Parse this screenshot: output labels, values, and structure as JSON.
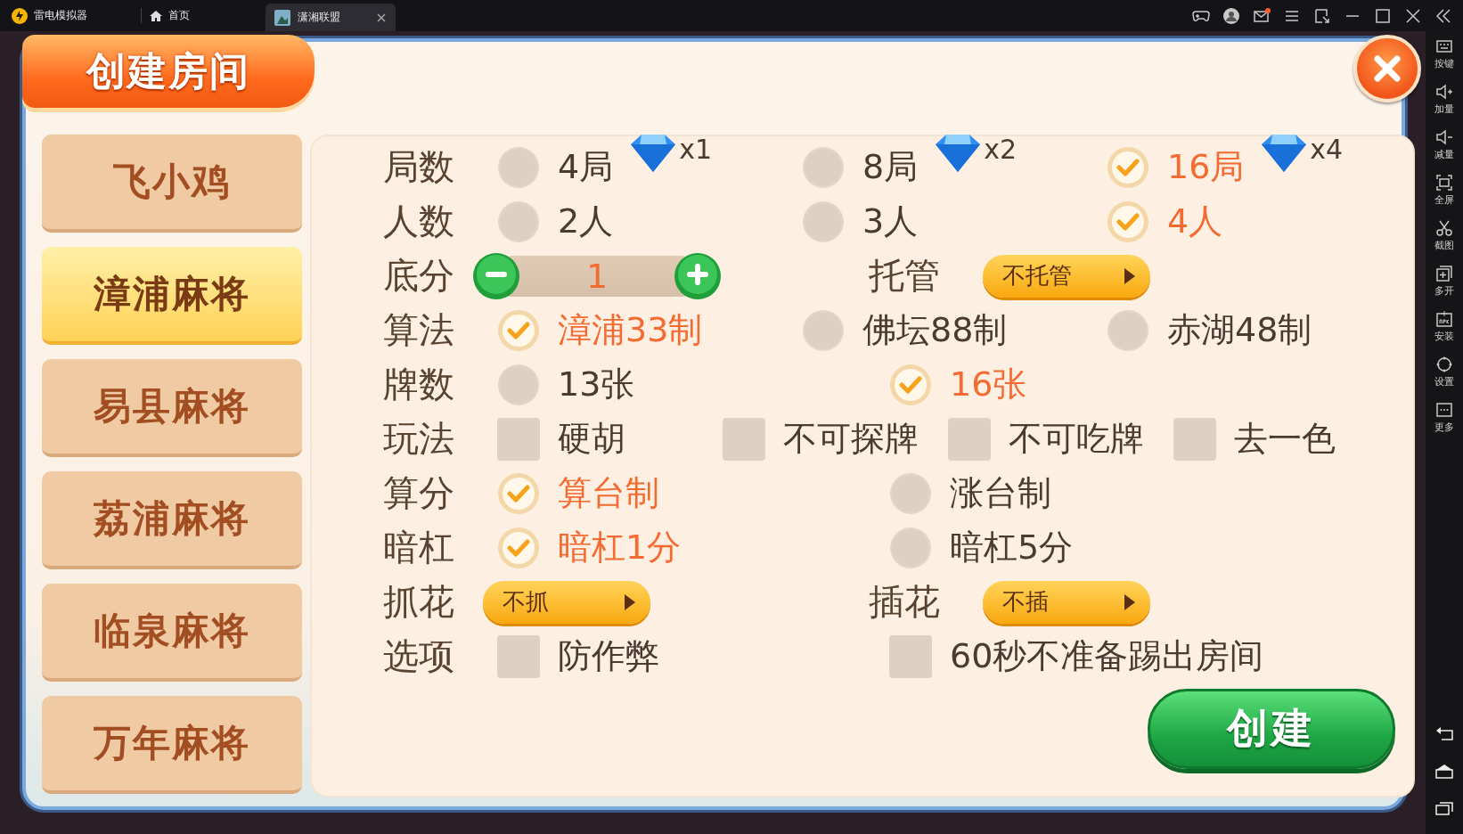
{
  "titlebar": {
    "app_name": "雷电模拟器",
    "home_tab": "首页",
    "tabs": [
      {
        "label": "潇湘联盟",
        "selected": true
      }
    ]
  },
  "sidebar": {
    "items": [
      {
        "label": "按键"
      },
      {
        "label": "加量"
      },
      {
        "label": "减量"
      },
      {
        "label": "全屏"
      },
      {
        "label": "截图"
      },
      {
        "label": "多开"
      },
      {
        "label": "安装"
      },
      {
        "label": "设置"
      },
      {
        "label": "更多"
      }
    ]
  },
  "dialog": {
    "title": "创建房间",
    "games": [
      {
        "label": "飞小鸡",
        "selected": false
      },
      {
        "label": "漳浦麻将",
        "selected": true
      },
      {
        "label": "易县麻将",
        "selected": false
      },
      {
        "label": "荔浦麻将",
        "selected": false
      },
      {
        "label": "临泉麻将",
        "selected": false
      },
      {
        "label": "万年麻将",
        "selected": false
      }
    ],
    "rows": [
      {
        "label": "局数",
        "kind": "radio3",
        "options": [
          {
            "label": "4局",
            "cost": "x1",
            "selected": false
          },
          {
            "label": "8局",
            "cost": "x2",
            "selected": false
          },
          {
            "label": "16局",
            "cost": "x4",
            "selected": true
          }
        ]
      },
      {
        "label": "人数",
        "kind": "radio3",
        "options": [
          {
            "label": "2人",
            "selected": false
          },
          {
            "label": "3人",
            "selected": false
          },
          {
            "label": "4人",
            "selected": true
          }
        ]
      },
      {
        "label": "底分",
        "kind": "stepper",
        "value": "1",
        "extra_label": "托管",
        "extra_dropdown": "不托管"
      },
      {
        "label": "算法",
        "kind": "radio3",
        "options": [
          {
            "label": "漳浦33制",
            "selected": true
          },
          {
            "label": "佛坛88制",
            "selected": false
          },
          {
            "label": "赤湖48制",
            "selected": false
          }
        ]
      },
      {
        "label": "牌数",
        "kind": "radio2",
        "options": [
          {
            "label": "13张",
            "selected": false
          },
          {
            "label": "16张",
            "selected": true
          }
        ]
      },
      {
        "label": "玩法",
        "kind": "check4",
        "options": [
          {
            "label": "硬胡",
            "checked": false
          },
          {
            "label": "不可探牌",
            "checked": false
          },
          {
            "label": "不可吃牌",
            "checked": false
          },
          {
            "label": "去一色",
            "checked": false
          }
        ]
      },
      {
        "label": "算分",
        "kind": "radio2",
        "options": [
          {
            "label": "算台制",
            "selected": true
          },
          {
            "label": "涨台制",
            "selected": false
          }
        ]
      },
      {
        "label": "暗杠",
        "kind": "radio2",
        "options": [
          {
            "label": "暗杠1分",
            "selected": true
          },
          {
            "label": "暗杠5分",
            "selected": false
          }
        ]
      },
      {
        "label": "抓花",
        "kind": "dropdowns",
        "dropdown": "不抓",
        "extra_label": "插花",
        "extra_dropdown": "不插"
      },
      {
        "label": "选项",
        "kind": "check2",
        "options": [
          {
            "label": "防作弊",
            "checked": false
          },
          {
            "label": "60秒不准备踢出房间",
            "checked": false
          }
        ]
      }
    ],
    "create_button": "创建"
  }
}
